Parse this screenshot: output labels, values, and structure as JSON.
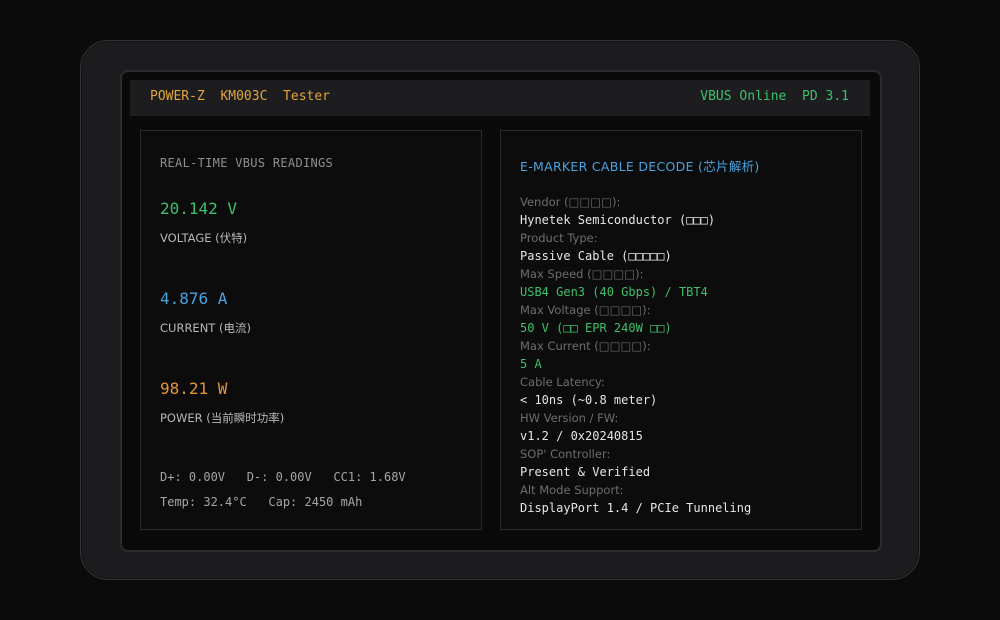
{
  "status_bar": {
    "device_title": "POWER-Z  KM003C  Tester",
    "connection_status": "VBUS Online  PD 3.1",
    "title_color": "#e3a53a",
    "status_color": "#3fbf6b"
  },
  "readings_panel": {
    "title": "REAL-TIME VBUS READINGS",
    "readings": [
      {
        "value": "20.142 V",
        "label": "VOLTAGE (伏特)",
        "color": "#3fbf6b"
      },
      {
        "value": "4.876 A",
        "label": "CURRENT (电流)",
        "color": "#4aa3df"
      },
      {
        "value": "98.21 W",
        "label": "POWER (当前瞬时功率)",
        "color": "#e3953a"
      }
    ],
    "line_signals": "D+: 0.00V   D-: 0.00V   CC1: 1.68V",
    "line_temp_cap": "Temp: 32.4°C   Cap: 2450 mAh"
  },
  "emarker_panel": {
    "title": "E-MARKER CABLE DECODE (芯片解析)",
    "title_color": "#4aa3df",
    "fields": [
      {
        "label": "Vendor (□□□□):",
        "value": "Hynetek Semiconductor (□□□)",
        "color": "#e6e6e6"
      },
      {
        "label": "Product Type:",
        "value": "Passive Cable (□□□□□)",
        "color": "#e6e6e6"
      },
      {
        "label": "Max Speed (□□□□):",
        "value": "USB4 Gen3 (40 Gbps) / TBT4",
        "color": "#3fbf6b"
      },
      {
        "label": "Max Voltage (□□□□):",
        "value": "50 V (□□ EPR 240W □□)",
        "color": "#3fbf6b"
      },
      {
        "label": "Max Current (□□□□):",
        "value": "5 A",
        "color": "#3fbf6b"
      },
      {
        "label": "Cable Latency:",
        "value": "< 10ns (~0.8 meter)",
        "color": "#e6e6e6"
      },
      {
        "label": "HW Version / FW:",
        "value": "v1.2 / 0x20240815",
        "color": "#e6e6e6"
      },
      {
        "label": "SOP' Controller:",
        "value": "Present & Verified",
        "color": "#e6e6e6"
      },
      {
        "label": "Alt Mode Support:",
        "value": "DisplayPort 1.4 / PCIe Tunneling",
        "color": "#e6e6e6"
      }
    ]
  }
}
